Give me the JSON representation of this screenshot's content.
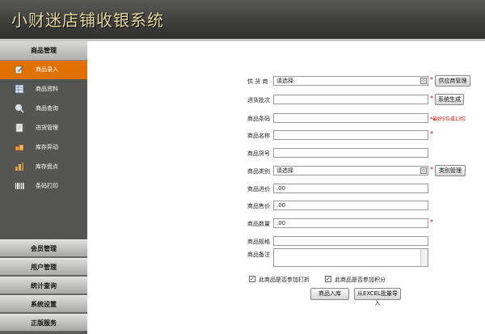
{
  "app": {
    "title": "小财迷店铺收银系统"
  },
  "sidebar": {
    "header": "商品管理",
    "items": [
      {
        "label": "商品录入",
        "icon": "pencil-icon"
      },
      {
        "label": "商品资料",
        "icon": "table-icon"
      },
      {
        "label": "商品查询",
        "icon": "magnifier-icon"
      },
      {
        "label": "进货管理",
        "icon": "clipboard-icon"
      },
      {
        "label": "库存异动",
        "icon": "boxes-icon"
      },
      {
        "label": "库存盘点",
        "icon": "chart-icon"
      },
      {
        "label": "条码打印",
        "icon": "barcode-icon"
      }
    ],
    "groups": [
      "会员管理",
      "用户管理",
      "统计查询",
      "系统设置",
      "正版服务"
    ]
  },
  "form": {
    "supplier_label": "供 货 商",
    "supplier_value": "请选择",
    "supplier_button": "供应商管理",
    "batch_label": "进货批次",
    "batch_button": "系统生成",
    "barcode_label": "商品条码",
    "barcode_hint": "*最好5位或13位",
    "name_label": "商品名称",
    "sku_label": "商品货号",
    "category_label": "商品类别",
    "category_value": "请选择",
    "category_button": "类别管理",
    "cost_label": "商品进价",
    "cost_value": ".00",
    "price_label": "商品售价",
    "price_value": ".00",
    "qty_label": "商品数量",
    "qty_value": ".00",
    "spec_label": "商品规格",
    "note_label": "商品备注",
    "discount_label": "此商品是否参加打折",
    "points_label": "此商品是否参加积分",
    "submit_button": "商品入库",
    "import_button": "从EXCEL批量导入",
    "required_mark": "*",
    "checked_mark": "✓",
    "dropdown_glyph": "◇"
  }
}
